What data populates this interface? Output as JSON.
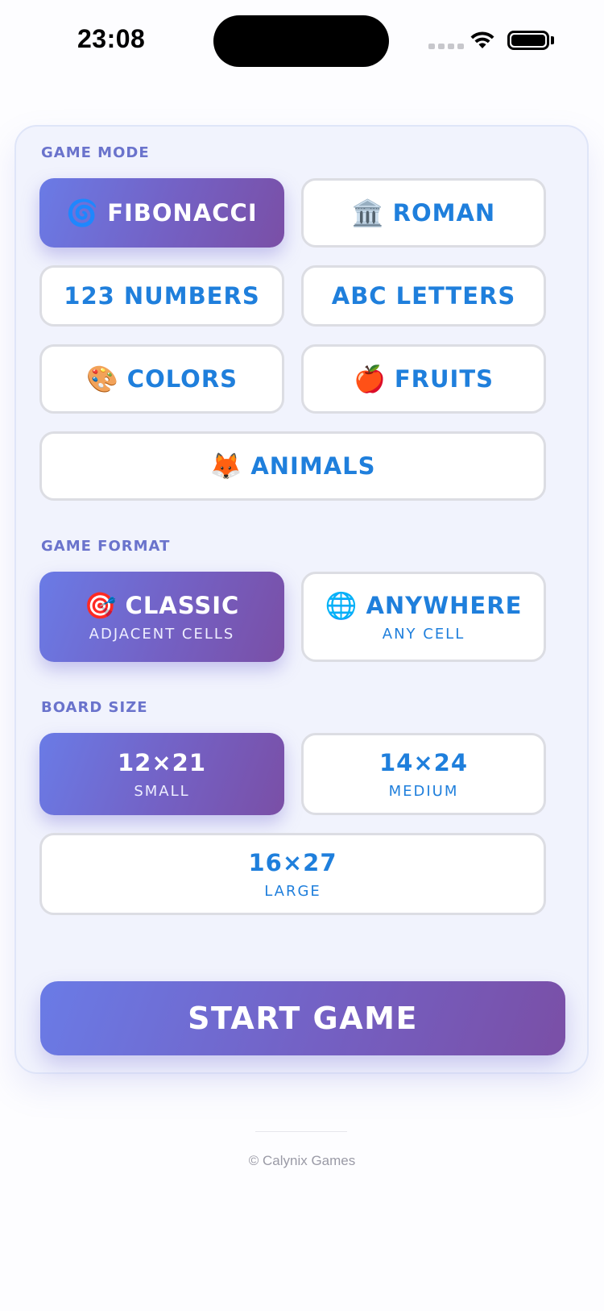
{
  "status_bar": {
    "time": "23:08"
  },
  "game_mode": {
    "label": "GAME MODE",
    "options": [
      {
        "emoji": "🌀",
        "label": "FIBONACCI",
        "selected": true
      },
      {
        "emoji": "🏛️",
        "label": "ROMAN",
        "selected": false
      },
      {
        "emoji": "",
        "label": "123 NUMBERS",
        "selected": false
      },
      {
        "emoji": "",
        "label": "ABC LETTERS",
        "selected": false
      },
      {
        "emoji": "🎨",
        "label": "COLORS",
        "selected": false
      },
      {
        "emoji": "🍎",
        "label": "FRUITS",
        "selected": false
      },
      {
        "emoji": "🦊",
        "label": "ANIMALS",
        "selected": false
      }
    ]
  },
  "game_format": {
    "label": "GAME FORMAT",
    "options": [
      {
        "emoji": "🎯",
        "label": "CLASSIC",
        "sub": "ADJACENT CELLS",
        "selected": true
      },
      {
        "emoji": "🌐",
        "label": "ANYWHERE",
        "sub": "ANY CELL",
        "selected": false
      }
    ]
  },
  "board_size": {
    "label": "BOARD SIZE",
    "options": [
      {
        "label": "12×21",
        "sub": "SMALL",
        "selected": true
      },
      {
        "label": "14×24",
        "sub": "MEDIUM",
        "selected": false
      },
      {
        "label": "16×27",
        "sub": "LARGE",
        "selected": false
      }
    ]
  },
  "start_button": "START GAME",
  "footer": "© Calynix Games",
  "colors": {
    "accent_start": "#6a7be6",
    "accent_end": "#7a4fa6",
    "option_text": "#1f7fdc",
    "section_label": "#6a73cc"
  }
}
